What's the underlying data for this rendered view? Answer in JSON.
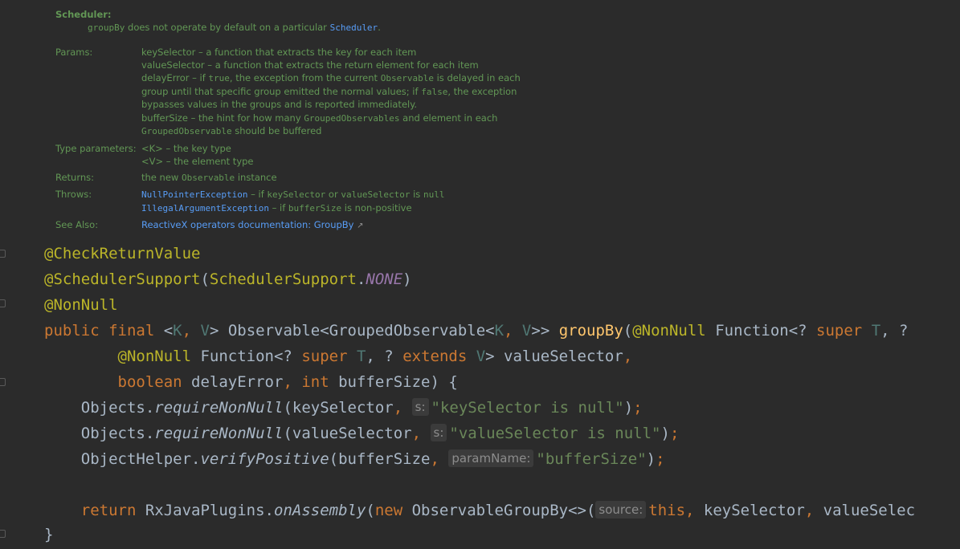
{
  "doc": {
    "scheduler_heading": "Scheduler:",
    "scheduler_text_pre": "groupBy",
    "scheduler_text_mid": " does not operate by default on a particular ",
    "scheduler_text_link": "Scheduler",
    "scheduler_text_post": ".",
    "params_label": "Params:",
    "params": {
      "l1": "keySelector – a function that extracts the key for each item",
      "l2": "valueSelector – a function that extracts the return element for each item",
      "l3a": "delayError – if ",
      "l3b": "true",
      "l3c": ", the exception from the current ",
      "l3d": "Observable",
      "l3e": " is delayed in each",
      "l4a": "group until that specific group emitted the normal values; if ",
      "l4b": "false",
      "l4c": ", the exception",
      "l5": "bypasses values in the groups and is reported immediately.",
      "l6a": "bufferSize – the hint for how many ",
      "l6b": "GroupedObservables",
      "l6c": " and element in each",
      "l7a": "GroupedObservable",
      "l7b": " should be buffered"
    },
    "type_params_label": "Type parameters:",
    "type_params": {
      "l1": "<K> – the key type",
      "l2": "<V> – the element type"
    },
    "returns_label": "Returns:",
    "returns": {
      "a": "the new ",
      "b": "Observable",
      "c": " instance"
    },
    "throws_label": "Throws:",
    "throws": {
      "l1a": "NullPointerException",
      "l1b": " – if ",
      "l1c": "keySelector",
      "l1d": " or ",
      "l1e": "valueSelector",
      "l1f": " is ",
      "l1g": "null",
      "l2a": "IllegalArgumentException",
      "l2b": " – if ",
      "l2c": "bufferSize",
      "l2d": " is non-positive"
    },
    "see_also_label": "See Also:",
    "see_also_link": "ReactiveX operators documentation: GroupBy",
    "see_also_arrow": "↗"
  },
  "code": {
    "line1": {
      "ann": "@CheckReturnValue"
    },
    "line2": {
      "ann": "@SchedulerSupport",
      "p1": "(",
      "ann2": "SchedulerSupport",
      "dot": ".",
      "const": "NONE",
      "p2": ")"
    },
    "line3": {
      "ann": "@NonNull"
    },
    "line4": {
      "kw1": "public final ",
      "lt": "<",
      "tK": "K",
      "comma1": ", ",
      "tV": "V",
      "gt": "> Observable<GroupedObservable<",
      "tK2": "K",
      "comma2": ", ",
      "tV2": "V",
      "gt2": ">> ",
      "fn": "groupBy",
      "p": "(",
      "ann": "@NonNull",
      "rest1": " Function<? ",
      "kw2": "super",
      "sp": " ",
      "tT": "T",
      "rest2": ", ?"
    },
    "line5": {
      "ann": "@NonNull",
      "rest1": " Function<? ",
      "kw1": "super",
      "sp": " ",
      "tT": "T",
      "rest2": ", ? ",
      "kw2": "extends",
      "sp2": " ",
      "tV": "V",
      "rest3": "> valueSelector",
      "comma": ","
    },
    "line6": {
      "kw1": "boolean",
      "rest1": " delayError",
      "comma": ",",
      "sp": " ",
      "kw2": "int",
      "rest2": " bufferSize) {"
    },
    "line7": {
      "obj": "Objects.",
      "method": "requireNonNull",
      "args": "(keySelector",
      "comma": ",",
      "hint": "s:",
      "str": "\"keySelector is null\"",
      "end": ")",
      "semi": ";"
    },
    "line8": {
      "obj": "Objects.",
      "method": "requireNonNull",
      "args": "(valueSelector",
      "comma": ",",
      "hint": "s:",
      "str": "\"valueSelector is null\"",
      "end": ")",
      "semi": ";"
    },
    "line9": {
      "obj": "ObjectHelper.",
      "method": "verifyPositive",
      "args": "(bufferSize",
      "comma": ",",
      "hint": "paramName:",
      "str": "\"bufferSize\"",
      "end": ")",
      "semi": ";"
    },
    "line10": {
      "kw1": "return",
      "rest1": " RxJavaPlugins.",
      "method": "onAssembly",
      "p": "(",
      "kw2": "new",
      "rest2": " ObservableGroupBy<>(",
      "hint": "source:",
      "kw3": "this",
      "comma": ",",
      "rest3": " keySelector",
      "comma2": ",",
      "rest4": " valueSelec"
    },
    "line11": {
      "brace": "}"
    }
  }
}
